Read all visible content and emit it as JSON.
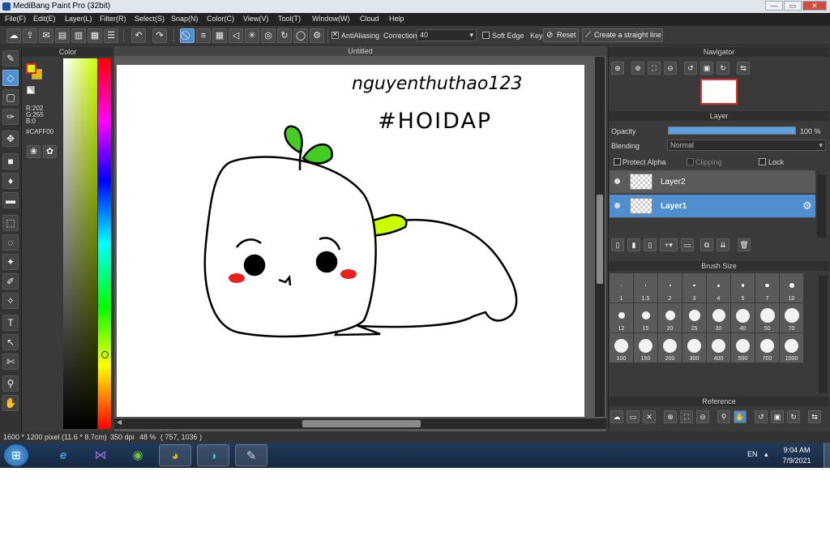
{
  "window": {
    "title": "MediBang Paint Pro (32bit)",
    "minimize": "—",
    "maximize": "▭",
    "close": "✕"
  },
  "menu": [
    "File(F)",
    "Edit(E)",
    "Layer(L)",
    "Filter(R)",
    "Select(S)",
    "Snap(N)",
    "Color(C)",
    "View(V)",
    "Tool(T)",
    "Window(W)",
    "Cloud",
    "Help"
  ],
  "toolbar": {
    "antialiasing_label": "AntiAliasing",
    "correction_label": "Correction",
    "correction_value": "40",
    "soft_edge_label": "Soft Edge",
    "key_label": "Key",
    "reset_label": "Reset",
    "straight_line_label": "Create a straight line"
  },
  "color_panel": {
    "title": "Color",
    "r": "R:202",
    "g": "G:255",
    "b": "B:0",
    "hex": "#CAFF00",
    "foreground": "#caff00",
    "background": "#e8b900"
  },
  "document": {
    "tab_title": "Untitled",
    "handwriting_line1": "nguyenthuthao123",
    "handwriting_line2": "#HOIDAP"
  },
  "navigator": {
    "title": "Navigator"
  },
  "layer_panel": {
    "title": "Layer",
    "opacity_label": "Opacity",
    "opacity_value": "100 %",
    "opacity_fraction": 1.0,
    "blending_label": "Blending",
    "blending_value": "Normal",
    "protect_alpha_label": "Protect Alpha",
    "clipping_label": "Clipping",
    "lock_label": "Lock",
    "layers": [
      {
        "name": "Layer2",
        "selected": false
      },
      {
        "name": "Layer1",
        "selected": true
      }
    ]
  },
  "brush_panel": {
    "title": "Brush Size",
    "sizes": [
      "1",
      "1.5",
      "2",
      "3",
      "4",
      "5",
      "7",
      "10",
      "12",
      "15",
      "20",
      "25",
      "30",
      "40",
      "50",
      "70",
      "100",
      "150",
      "200",
      "300",
      "400",
      "500",
      "700",
      "1000"
    ]
  },
  "reference_panel": {
    "title": "Reference"
  },
  "status": {
    "dimensions": "1600 * 1200 pixel",
    "physical": "(11.6 * 8.7cm)",
    "dpi": "350 dpi",
    "zoom": "48 %",
    "cursor": "( 757, 1036 )"
  },
  "taskbar": {
    "language": "EN",
    "time": "9:04 AM",
    "date": "7/9/2021"
  },
  "icons": {
    "pen": "pen-icon",
    "eraser": "eraser-icon",
    "move": "move-icon"
  }
}
